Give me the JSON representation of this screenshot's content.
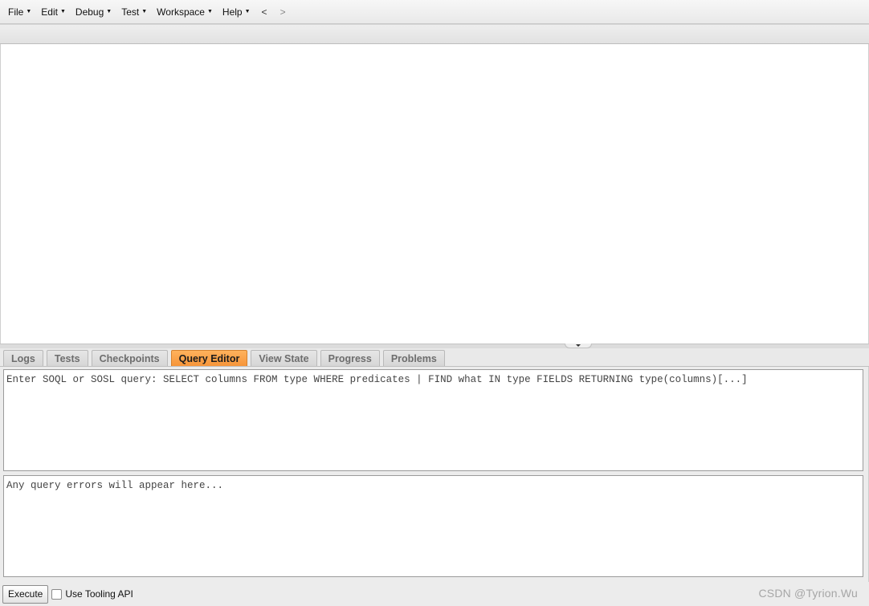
{
  "menubar": {
    "items": [
      {
        "label": "File"
      },
      {
        "label": "Edit"
      },
      {
        "label": "Debug"
      },
      {
        "label": "Test"
      },
      {
        "label": "Workspace"
      },
      {
        "label": "Help"
      }
    ],
    "back": "<",
    "forward": ">"
  },
  "tabs": [
    {
      "label": "Logs"
    },
    {
      "label": "Tests"
    },
    {
      "label": "Checkpoints"
    },
    {
      "label": "Query Editor",
      "active": true
    },
    {
      "label": "View State"
    },
    {
      "label": "Progress"
    },
    {
      "label": "Problems"
    }
  ],
  "query_editor": {
    "placeholder": "Enter SOQL or SOSL query: SELECT columns FROM type WHERE predicates | FIND what IN type FIELDS RETURNING type(columns)[...]",
    "errors_placeholder": "Any query errors will appear here..."
  },
  "bottom": {
    "execute_label": "Execute",
    "tooling_api_label": "Use Tooling API",
    "tooling_api_checked": false
  },
  "watermark": "CSDN @Tyrion.Wu",
  "colors": {
    "active_tab": "#f6953a"
  }
}
